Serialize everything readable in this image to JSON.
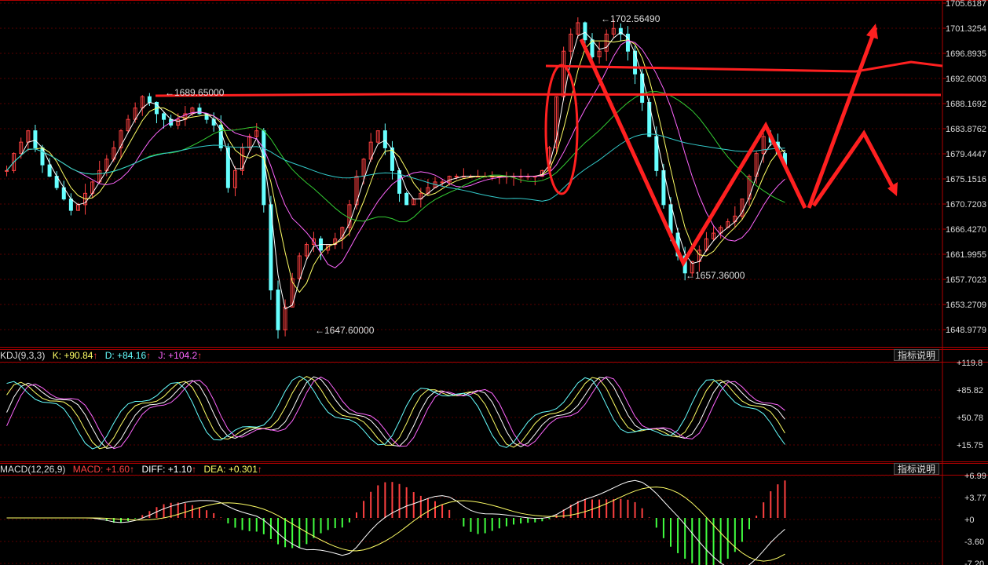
{
  "colors": {
    "background": "#000000",
    "grid": "#5a0000",
    "axis": "#b00000",
    "up": "#ff4040",
    "down": "#40ff40",
    "k_line": "#ffffff",
    "d_line": "#ffff66",
    "j_line": "#ff66ff",
    "ma_green": "#33cc33",
    "ma_cyan": "#33cccc",
    "annotation": "#ff2020"
  },
  "price_axis": {
    "ticks": [
      "1705.6187",
      "1701.3254",
      "1696.8935",
      "1692.6003",
      "1688.1692",
      "1683.8762",
      "1679.4447",
      "1675.1516",
      "1670.7203",
      "1666.4270",
      "1661.9955",
      "1657.7023",
      "1653.2709",
      "1648.9779"
    ]
  },
  "price_labels": {
    "high_left": "1689.65000",
    "high_top": "1702.56490",
    "low_right": "1657.36000",
    "low_left": "1647.60000"
  },
  "kdj": {
    "title": "KDJ(9,3,3)",
    "k": "K: +90.84",
    "d": "D: +84.16",
    "j": "J: +104.2",
    "help": "指标说明",
    "ticks": [
      "+119.8",
      "+85.82",
      "+50.78",
      "+15.75"
    ]
  },
  "macd": {
    "title": "MACD(12,26,9)",
    "macd": "MACD: +1.60",
    "diff": "DIFF: +1.10",
    "dea": "DEA: +0.301",
    "help": "指标说明",
    "ticks": [
      "+6.99",
      "+3.77",
      "+0",
      "-3.60",
      "-7.20"
    ]
  },
  "chart_data": {
    "type": "candlestick",
    "y_range": [
      1645,
      1706
    ],
    "close": [
      1676,
      1679,
      1681,
      1683,
      1680,
      1677,
      1675,
      1673,
      1671,
      1669,
      1670,
      1672,
      1674,
      1676,
      1678,
      1680,
      1683,
      1685,
      1687,
      1689,
      1688,
      1686,
      1685,
      1684,
      1685,
      1686,
      1687,
      1686,
      1685,
      1684,
      1680,
      1673,
      1676,
      1680,
      1682,
      1683,
      1670,
      1655,
      1648,
      1652,
      1657,
      1661,
      1663,
      1664,
      1662,
      1663,
      1664,
      1666,
      1670,
      1675,
      1678,
      1681,
      1683,
      1680,
      1676,
      1672,
      1670,
      1671,
      1672,
      1673,
      1674,
      1674,
      1675,
      1675,
      1675,
      1675,
      1675,
      1675,
      1675,
      1675,
      1675,
      1675,
      1675,
      1675,
      1675,
      1676,
      1680,
      1689,
      1697,
      1700,
      1702,
      1699,
      1696,
      1697,
      1700,
      1701,
      1700,
      1697,
      1693,
      1688,
      1682,
      1676,
      1670,
      1665,
      1661,
      1658,
      1660,
      1662,
      1664,
      1665,
      1666,
      1667,
      1668,
      1671,
      1675,
      1679,
      1682,
      1681,
      1679,
      1677
    ],
    "extremes": {
      "high": 1702.5649,
      "low": 1647.6,
      "secondary_high": 1689.65,
      "secondary_low": 1657.36
    },
    "kdj_latest": {
      "k": 90.84,
      "d": 84.16,
      "j": 104.2
    },
    "macd_latest": {
      "macd": 1.6,
      "diff": 1.1,
      "dea": 0.301
    }
  }
}
